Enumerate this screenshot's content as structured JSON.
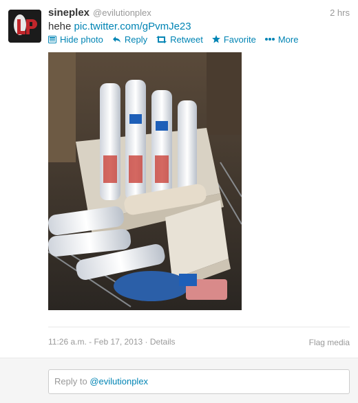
{
  "tweet": {
    "name": "sineplex",
    "handle": "@evilutionplex",
    "time": "2 hrs",
    "text_prefix": "hehe ",
    "link": "pic.twitter.com/gPvmJe23"
  },
  "actions": [
    {
      "label": "Hide photo",
      "icon": "photo-icon"
    },
    {
      "label": "Reply",
      "icon": "reply-arrow-icon"
    },
    {
      "label": "Retweet",
      "icon": "retweet-icon"
    },
    {
      "label": "Favorite",
      "icon": "star-icon"
    },
    {
      "label": "More",
      "icon": "more-dots-icon"
    }
  ],
  "meta": {
    "timestamp": "11:26 a.m. - Feb 17, 2013",
    "separator": " · ",
    "details": "Details",
    "flag": "Flag media"
  },
  "reply": {
    "prefix": "Reply to ",
    "mention": "@evilutionplex"
  },
  "colors": {
    "link": "#0084b4",
    "muted": "#999999",
    "text": "#333333"
  }
}
